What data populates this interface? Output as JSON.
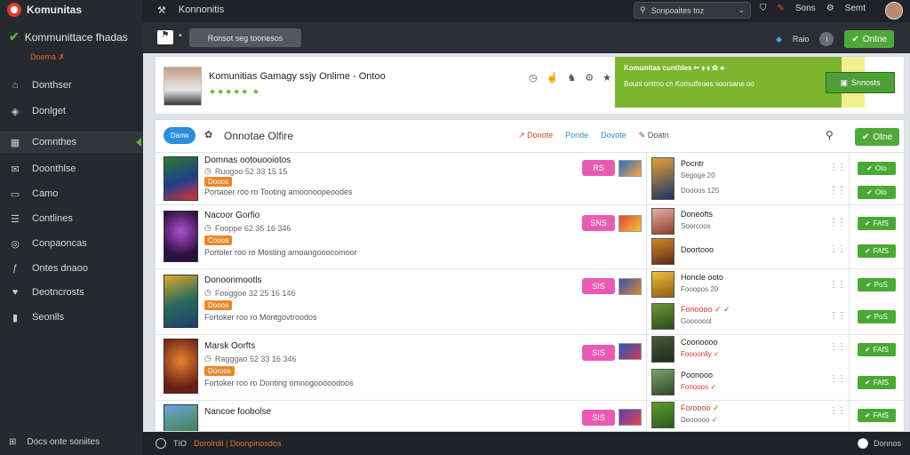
{
  "app": {
    "name": "Komunitas"
  },
  "sidebar": {
    "brand": "Kommunittace fhadas",
    "sub": "Doema ✗",
    "items": [
      {
        "label": "Donthser",
        "icon": "home-icon"
      },
      {
        "label": "Donlget",
        "icon": "tag-icon"
      },
      {
        "label": "Comnthes",
        "icon": "grid-icon"
      },
      {
        "label": "Doonthlse",
        "icon": "mail-icon"
      },
      {
        "label": "Camo",
        "icon": "chat-icon"
      },
      {
        "label": "Contlines",
        "icon": "list-icon"
      },
      {
        "label": "Conpaoncas",
        "icon": "globe-icon"
      },
      {
        "label": "Ontes dnaoo",
        "icon": "facebook-icon"
      },
      {
        "label": "Deotncrosts",
        "icon": "heart-icon"
      },
      {
        "label": "Seonlls",
        "icon": "bookmark-icon"
      }
    ],
    "footer": "Docs onte soniites"
  },
  "topbar": {
    "title": "Konnonitis",
    "search_placeholder": "Sonpoaites toz",
    "item1": "Sons",
    "item2": "Semt"
  },
  "subbar": {
    "tab": "Ronsot seg toonesos",
    "right_label": "Raio",
    "online_btn": "Ontne"
  },
  "hero": {
    "title": "Komunitias Gamagy ssjy  Onlime - Ontoo",
    "stars": "★★★★★ ★",
    "promo_line1": "Komunitas cunthles ✂ ⬧ ⬧ ✿ ♣",
    "promo_line2": "Bouni ontmo cn Komutfeoes soorsane oo",
    "cta": "Snnosts"
  },
  "panel": {
    "pill": "Danw",
    "title": "Onnotae Olfire",
    "link1": "Donote",
    "link2": "Ponde",
    "link3": "Dovote",
    "link4": "Doatn",
    "online": "Otne"
  },
  "rows": [
    {
      "name": "Domnas ootouooiotos",
      "meta": "Ruugoo 52 33 15 15",
      "tag": "Dooos",
      "desc": "Portaoer roo ro Tooting amoonoopeoodes",
      "pink": "RS"
    },
    {
      "name": "Nacoor Gorfio",
      "meta": "Fooppe 62 35 16 346",
      "tag": "Cooos",
      "desc": "Portoler roo ro Mosting amoangooocomoor",
      "pink": "SNS"
    },
    {
      "name": "Donoonmootls",
      "meta": "Fooggoe 32 25 16 146",
      "tag": "Dooos",
      "desc": "Fortoker roo ro Montgovtroodos",
      "pink": "SIS"
    },
    {
      "name": "Marsk Oorfts",
      "meta": "Ragggao 52 33 16 346",
      "tag": "Doroos",
      "desc": "Fortoker roo ro Donting omnogooooodoos",
      "pink": "SIS"
    },
    {
      "name": "Nancoe foobolse",
      "meta": "",
      "tag": "",
      "desc": "",
      "pink": "SIS"
    }
  ],
  "subitems": [
    {
      "name": "Pocntr",
      "meta": "Segoge 20",
      "meta2": "Doooos 125",
      "red": false
    },
    {
      "name": "Doneofts",
      "meta": "Soorcoos",
      "meta2": "Doortooo",
      "red": false
    },
    {
      "name": "Honcle ooto",
      "meta": "Fooopos 20",
      "meta2": "",
      "red": false
    },
    {
      "name": "Fonoooo ✓ ✓",
      "meta": "Gooooool",
      "meta2": "",
      "red": true
    },
    {
      "name": "Coonoooo",
      "meta": "Foooonlly ✓",
      "meta2": "",
      "red": false
    },
    {
      "name": "Poonooo",
      "meta": "Fonooos ✓",
      "meta2": "",
      "red": true
    },
    {
      "name": "Foroooo ✓",
      "meta": "Doooooo ✓",
      "meta2": "",
      "red": true
    }
  ],
  "green_buttons": [
    "Oto",
    "Oto",
    "FAfS",
    "FAfS",
    "PoS",
    "PoS",
    "FAfS",
    "FAfS",
    "FAtS"
  ],
  "statusbar": {
    "num": "TIO",
    "orange": "Dorolrdil | Doonpinosdos",
    "right": "Donnos"
  }
}
